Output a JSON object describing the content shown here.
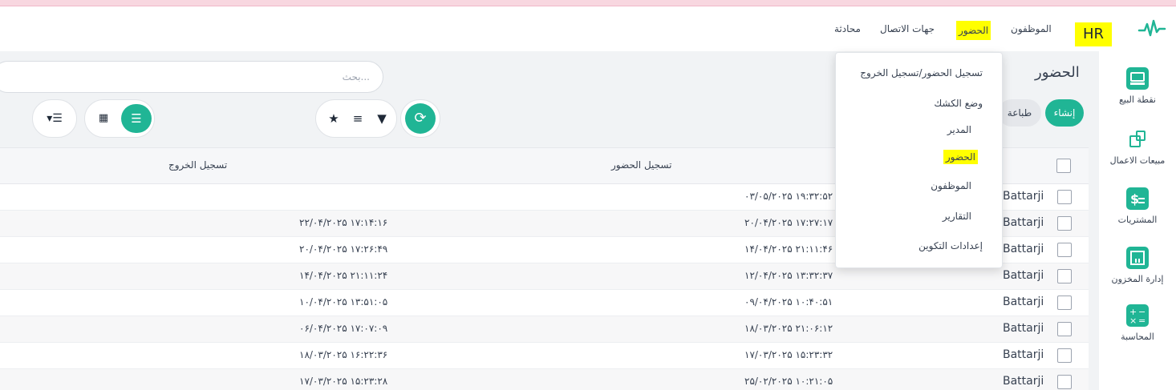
{
  "topbar": {
    "brand": "HR",
    "nav": [
      "الموظفون",
      "الحضور",
      "جهات الاتصال",
      "محادثة"
    ]
  },
  "sidebar": {
    "items": [
      {
        "label": "نقطة البيع",
        "icon": "pos-icon"
      },
      {
        "label": "مبيعات الاعمال",
        "icon": "sales-icon"
      },
      {
        "label": "المشتريات",
        "icon": "purchase-icon"
      },
      {
        "label": "إدارة المخزون",
        "icon": "inventory-icon"
      },
      {
        "label": "المحاسبة",
        "icon": "accounting-icon"
      }
    ]
  },
  "page": {
    "title": "الحضور",
    "search_placeholder": "بحث...",
    "create_label": "إنشاء",
    "print_label": "طباعة"
  },
  "dropdown": {
    "items": [
      "تسجيل الحضور/تسجيل الخروج",
      "وضع الكشك",
      "المدير",
      "الحضور",
      "الموظفون",
      "التقارير",
      "إعدادات التكوين"
    ]
  },
  "table": {
    "headers": {
      "check_in": "تسجيل الحضور",
      "check_out": "تسجيل الخروج"
    },
    "rows": [
      {
        "employee": "Battarji",
        "check_in": "۰۳/۰۵/۲۰۲۵ ۱۹:۳۲:۵۲",
        "check_out": ""
      },
      {
        "employee": "Battarji",
        "check_in": "۲۰/۰۴/۲۰۲۵ ۱۷:۲۷:۱۷",
        "check_out": "۲۲/۰۴/۲۰۲۵ ۱۷:۱۴:۱۶"
      },
      {
        "employee": "Battarji",
        "check_in": "۱۴/۰۴/۲۰۲۵ ۲۱:۱۱:۴۶",
        "check_out": "۲۰/۰۴/۲۰۲۵ ۱۷:۲۶:۴۹"
      },
      {
        "employee": "Battarji",
        "check_in": "۱۲/۰۴/۲۰۲۵ ۱۳:۳۲:۳۷",
        "check_out": "۱۴/۰۴/۲۰۲۵ ۲۱:۱۱:۲۴"
      },
      {
        "employee": "Battarji",
        "check_in": "۰۹/۰۴/۲۰۲۵ ۱۰:۴۰:۵۱",
        "check_out": "۱۰/۰۴/۲۰۲۵ ۱۳:۵۱:۰۵"
      },
      {
        "employee": "Battarji",
        "check_in": "۱۸/۰۳/۲۰۲۵ ۲۱:۰۶:۱۲",
        "check_out": "۰۶/۰۴/۲۰۲۵ ۱۷:۰۷:۰۹"
      },
      {
        "employee": "Battarji",
        "check_in": "۱۷/۰۳/۲۰۲۵ ۱۵:۲۳:۳۲",
        "check_out": "۱۸/۰۳/۲۰۲۵ ۱۶:۲۲:۳۶"
      },
      {
        "employee": "Battarji",
        "check_in": "۲۵/۰۲/۲۰۲۵ ۱۰:۲۱:۰۵",
        "check_out": "۱۷/۰۳/۲۰۲۵ ۱۵:۲۳:۲۸"
      }
    ]
  },
  "colors": {
    "accent": "#20b595",
    "highlight": "#ffff00"
  }
}
